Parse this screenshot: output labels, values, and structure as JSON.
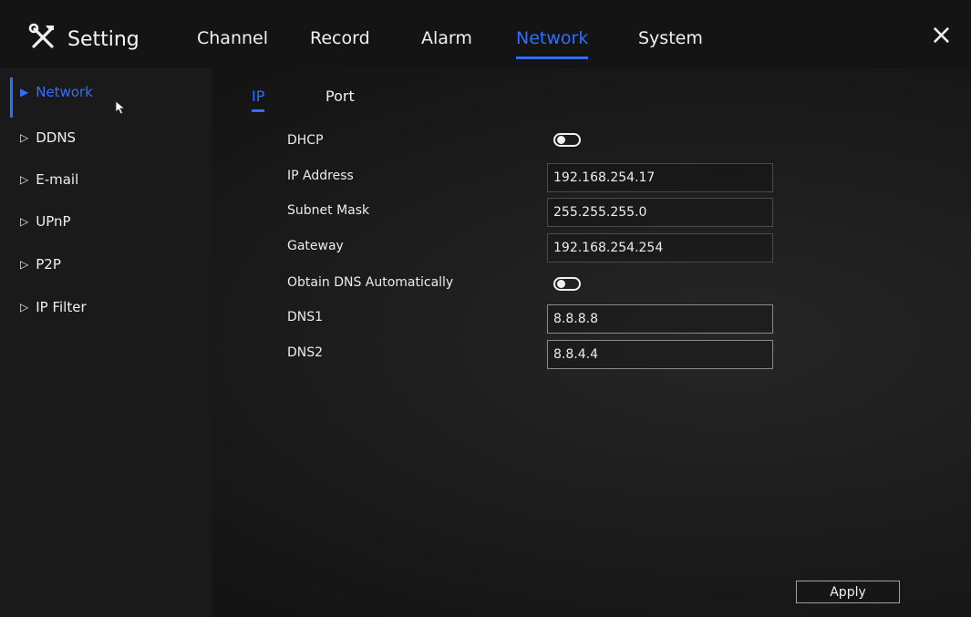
{
  "header": {
    "title": "Setting",
    "title_icon": "tools-icon",
    "tabs": [
      {
        "label": "Channel",
        "active": false
      },
      {
        "label": "Record",
        "active": false
      },
      {
        "label": "Alarm",
        "active": false
      },
      {
        "label": "Network",
        "active": true
      },
      {
        "label": "System",
        "active": false
      }
    ],
    "close_label": "×"
  },
  "sidebar": {
    "items": [
      {
        "label": "Network",
        "active": true
      },
      {
        "label": "DDNS",
        "active": false
      },
      {
        "label": "E-mail",
        "active": false
      },
      {
        "label": "UPnP",
        "active": false
      },
      {
        "label": "P2P",
        "active": false
      },
      {
        "label": "IP Filter",
        "active": false
      }
    ]
  },
  "subtabs": [
    {
      "label": "IP",
      "active": true
    },
    {
      "label": "Port",
      "active": false
    }
  ],
  "form": {
    "dhcp_label": "DHCP",
    "dhcp_enabled": false,
    "ip_label": "IP Address",
    "ip_value": "192.168.254.17",
    "subnet_label": "Subnet Mask",
    "subnet_value": "255.255.255.0",
    "gateway_label": "Gateway",
    "gateway_value": "192.168.254.254",
    "obtain_dns_label": "Obtain DNS Automatically",
    "obtain_dns_enabled": false,
    "dns1_label": "DNS1",
    "dns1_value": "8.8.8.8",
    "dns2_label": "DNS2",
    "dns2_value": "8.8.4.4"
  },
  "apply_label": "Apply",
  "colors": {
    "accent": "#2f6fff",
    "background": "#121212",
    "text": "#f0f0f0"
  }
}
